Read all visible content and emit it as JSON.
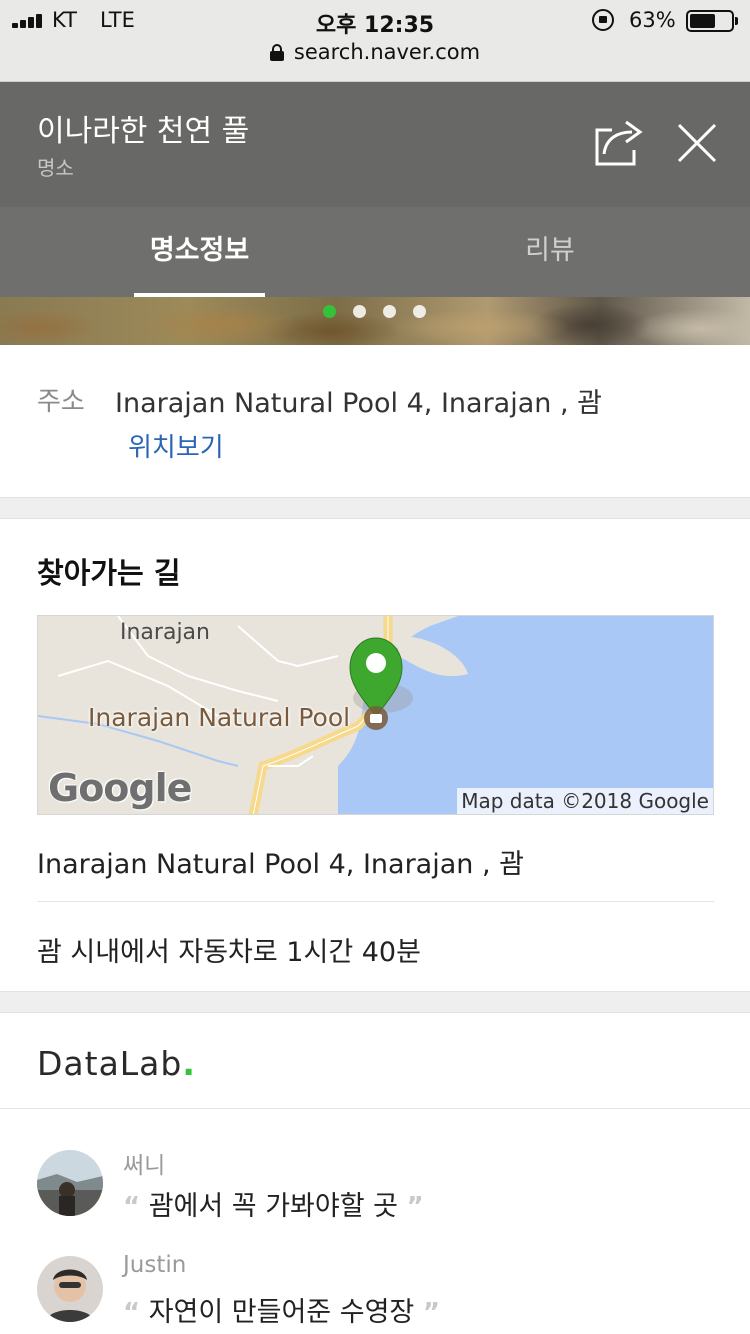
{
  "status_bar": {
    "carrier": "KT",
    "network": "LTE",
    "time": "오후 12:35",
    "battery_percent": "63%",
    "battery_level": 0.63
  },
  "url_bar": {
    "url": "search.naver.com"
  },
  "header": {
    "title": "이나라한 천연 풀",
    "category": "명소"
  },
  "tabs": [
    {
      "label": "명소정보",
      "active": true
    },
    {
      "label": "리뷰",
      "active": false
    }
  ],
  "carousel": {
    "page_count": 4,
    "active_index": 0,
    "accent_color": "#33c23a"
  },
  "address": {
    "label": "주소",
    "value": "Inarajan Natural Pool 4, Inarajan , 괌",
    "link": "위치보기",
    "link_color": "#2c64b8"
  },
  "directions": {
    "title": "찾아가는 길",
    "map": {
      "town_label": "Inarajan",
      "poi_label": "Inarajan Natural Pool",
      "logo_text": "Google",
      "copyright": "Map data ©2018 Google"
    },
    "address": "Inarajan Natural Pool 4, Inarajan , 괌",
    "travel_time": "괌 시내에서 자동차로 1시간 40분"
  },
  "datalab": {
    "logo_text": "DataLab",
    "logo_dot": "."
  },
  "reviews": [
    {
      "name": "써니",
      "text": "괌에서 꼭 가봐야할 곳"
    },
    {
      "name": "Justin",
      "text": "자연이 만들어준 수영장"
    }
  ],
  "quote_open": "“",
  "quote_close": "”"
}
